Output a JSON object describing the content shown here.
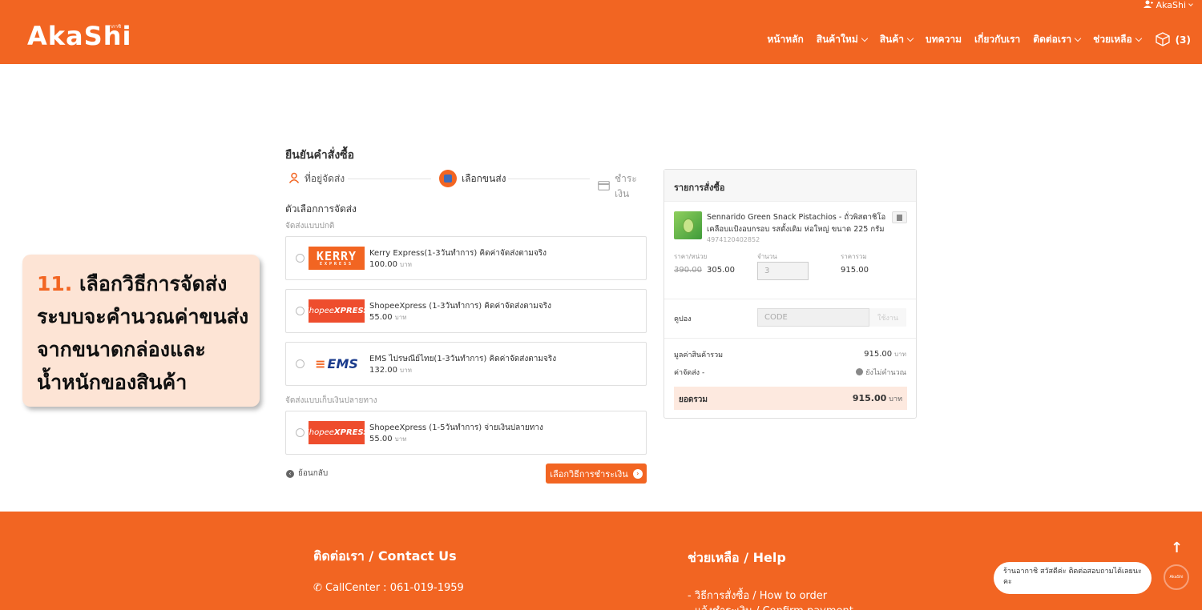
{
  "header": {
    "logo": "AkaShi",
    "logo_sub": "อากาชิ",
    "account": "AkaShi",
    "nav": [
      {
        "label": "หน้าหลัก",
        "dropdown": false
      },
      {
        "label": "สินค้าใหม่",
        "dropdown": true
      },
      {
        "label": "สินค้า",
        "dropdown": true
      },
      {
        "label": "บทความ",
        "dropdown": false
      },
      {
        "label": "เกี่ยวกับเรา",
        "dropdown": false
      },
      {
        "label": "ติดต่อเรา",
        "dropdown": true
      },
      {
        "label": "ช่วยเหลือ",
        "dropdown": true
      }
    ],
    "cart_count": "(3)"
  },
  "checkout": {
    "title": "ยืนยันคำสั่งซื้อ",
    "steps": [
      {
        "label": "ที่อยู่จัดส่ง",
        "state": "done"
      },
      {
        "label": "เลือกขนส่ง",
        "state": "active"
      },
      {
        "label": "ชำระเงิน",
        "state": "pending"
      }
    ],
    "section_title": "ตัวเลือกการจัดส่ง",
    "standard_label": "จัดส่งแบบปกติ",
    "cod_label": "จัดส่งแบบเก็บเงินปลายทาง",
    "currency": "บาท",
    "options": [
      {
        "name": "Kerry Express(1-3วันทำการ) คิดค่าจัดส่งตามจริง",
        "price": "100.00",
        "carrier": "kerry",
        "logo_text": "KERRY",
        "logo_sub": "EXPRESS"
      },
      {
        "name": "ShopeeXpress (1-3วันทำการ) คิดค่าจัดส่งตามจริง",
        "price": "55.00",
        "carrier": "shopee",
        "logo_text": "Shopee",
        "logo_bold": "XPRESS"
      },
      {
        "name": "EMS ไปรษณีย์ไทย(1-3วันทำการ) คิดค่าจัดส่งตามจริง",
        "price": "132.00",
        "carrier": "ems",
        "logo_text": "EMS"
      }
    ],
    "cod_options": [
      {
        "name": "ShopeeXpress (1-5วันทำการ) จ่ายเงินปลายทาง",
        "price": "55.00",
        "carrier": "shopee",
        "logo_text": "Shopee",
        "logo_bold": "XPRESS"
      }
    ],
    "back_label": "ย้อนกลับ",
    "next_label": "เลือกวิธีการชำระเงิน"
  },
  "summary": {
    "title": "รายการสั่งซื้อ",
    "product_name": "Sennarido Green Snack Pistachios - ถั่วพิสตาชิโอเคลือบแป้งอบกรอบ รสดั้งเดิม ห่อใหญ่ ขนาด 225 กรัม",
    "sku": "4974120402852",
    "unit_price_label": "ราคา/หน่วย",
    "qty_label": "จำนวน",
    "total_label": "ราคารวม",
    "old_price": "390.00",
    "price": "305.00",
    "qty": "3",
    "line_total": "915.00",
    "coupon_label": "คูปอง",
    "coupon_placeholder": "CODE",
    "coupon_button": "ใช้งาน",
    "subtotal_label": "มูลค่าสินค้ารวม",
    "subtotal": "915.00",
    "shipping_label": "ค่าจัดส่ง -",
    "shipping_value": "ยังไม่คำนวณ",
    "grand_label": "ยอดรวม",
    "grand_total": "915.00",
    "currency": "บาท"
  },
  "callout": {
    "number": "11.",
    "line1": "เลือกวิธีการจัดส่ง",
    "line2": "ระบบจะคำนวณค่าขนส่ง",
    "line3": "จากขนาดกล่องและ",
    "line4": "น้ำหนักของสินค้า"
  },
  "footer": {
    "contact_title": "ติดต่อเรา / Contact Us",
    "callcenter": "CallCenter : 061-019-1959",
    "help_title": "ช่วยเหลือ / Help",
    "help_link1": "- วิธีการสั่งซื้อ / How to order",
    "help_link2": "- แจ้งชำระเงิน / Confirm payment",
    "chat_text": "ร้านอากาชิ สวัสดีค่ะ ติดต่อสอบถามได้เลยนะคะ",
    "chat_avatar": "AkaShi"
  },
  "colors": {
    "brand": "#f26522",
    "step_icon": "#3f6cb8",
    "total_bg": "#fde9df",
    "callout_bg": "#fde4d5"
  }
}
